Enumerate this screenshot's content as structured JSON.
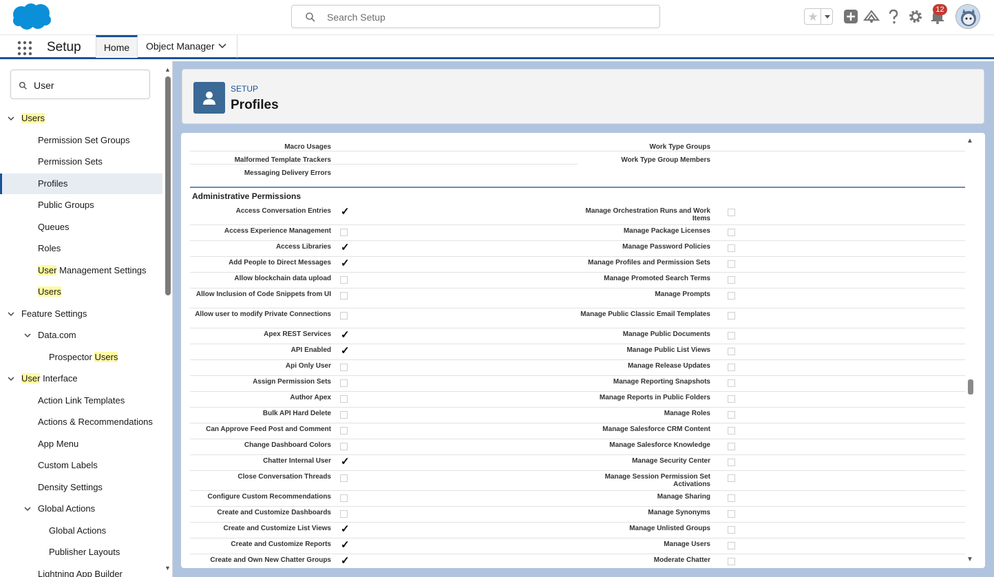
{
  "topbar": {
    "search_placeholder": "Search Setup",
    "notification_count": "12"
  },
  "nav": {
    "app_name": "Setup",
    "tabs": [
      "Home",
      "Object Manager"
    ]
  },
  "sidebar": {
    "search_value": "User",
    "items": [
      {
        "pre": "",
        "hl": "Users",
        "post": "",
        "level": 0,
        "chevron": "down"
      },
      {
        "pre": "Permission Set Groups",
        "hl": "",
        "post": "",
        "level": 1
      },
      {
        "pre": "Permission Sets",
        "hl": "",
        "post": "",
        "level": 1
      },
      {
        "pre": "Profiles",
        "hl": "",
        "post": "",
        "level": 1,
        "selected": true
      },
      {
        "pre": "Public Groups",
        "hl": "",
        "post": "",
        "level": 1
      },
      {
        "pre": "Queues",
        "hl": "",
        "post": "",
        "level": 1
      },
      {
        "pre": "Roles",
        "hl": "",
        "post": "",
        "level": 1
      },
      {
        "pre": "",
        "hl": "User",
        "post": " Management Settings",
        "level": 1
      },
      {
        "pre": "",
        "hl": "Users",
        "post": "",
        "level": 1
      },
      {
        "pre": "Feature Settings",
        "hl": "",
        "post": "",
        "level": 0,
        "chevron": "down"
      },
      {
        "pre": "Data.com",
        "hl": "",
        "post": "",
        "level": 1,
        "chevron": "down"
      },
      {
        "pre": "Prospector ",
        "hl": "Users",
        "post": "",
        "level": 2
      },
      {
        "pre": "",
        "hl": "User",
        "post": " Interface",
        "level": 0,
        "chevron": "down"
      },
      {
        "pre": "Action Link Templates",
        "hl": "",
        "post": "",
        "level": 1
      },
      {
        "pre": "Actions & Recommendations",
        "hl": "",
        "post": "",
        "level": 1
      },
      {
        "pre": "App Menu",
        "hl": "",
        "post": "",
        "level": 1
      },
      {
        "pre": "Custom Labels",
        "hl": "",
        "post": "",
        "level": 1
      },
      {
        "pre": "Density Settings",
        "hl": "",
        "post": "",
        "level": 1
      },
      {
        "pre": "Global Actions",
        "hl": "",
        "post": "",
        "level": 1,
        "chevron": "down"
      },
      {
        "pre": "Global Actions",
        "hl": "",
        "post": "",
        "level": 2
      },
      {
        "pre": "Publisher Layouts",
        "hl": "",
        "post": "",
        "level": 2
      },
      {
        "pre": "Lightning App Builder",
        "hl": "",
        "post": "",
        "level": 1
      }
    ]
  },
  "header": {
    "breadcrumb": "SETUP",
    "title": "Profiles"
  },
  "top_rows": {
    "left": [
      "Macro Usages",
      "Malformed Template Trackers",
      "Messaging Delivery Errors"
    ],
    "right": [
      "Work Type Groups",
      "Work Type Group Members"
    ]
  },
  "section_title": "Administrative Permissions",
  "permissions": [
    {
      "left": "Access Conversation Entries",
      "lc": true,
      "right": "Manage Orchestration Runs and Work Items",
      "rc": false
    },
    {
      "left": "Access Experience Management",
      "lc": false,
      "right": "Manage Package Licenses",
      "rc": false
    },
    {
      "left": "Access Libraries",
      "lc": true,
      "right": "Manage Password Policies",
      "rc": false
    },
    {
      "left": "Add People to Direct Messages",
      "lc": true,
      "right": "Manage Profiles and Permission Sets",
      "rc": false
    },
    {
      "left": "Allow blockchain data upload",
      "lc": false,
      "right": "Manage Promoted Search Terms",
      "rc": false
    },
    {
      "left": "Allow Inclusion of Code Snippets from UI",
      "lc": false,
      "right": "Manage Prompts",
      "rc": false
    },
    {
      "left": "Allow user to modify Private Connections",
      "lc": false,
      "right": "Manage Public Classic Email Templates",
      "rc": false
    },
    {
      "left": "Apex REST Services",
      "lc": true,
      "right": "Manage Public Documents",
      "rc": false
    },
    {
      "left": "API Enabled",
      "lc": true,
      "right": "Manage Public List Views",
      "rc": false
    },
    {
      "left": "Api Only User",
      "lc": false,
      "right": "Manage Release Updates",
      "rc": false
    },
    {
      "left": "Assign Permission Sets",
      "lc": false,
      "right": "Manage Reporting Snapshots",
      "rc": false
    },
    {
      "left": "Author Apex",
      "lc": false,
      "right": "Manage Reports in Public Folders",
      "rc": false
    },
    {
      "left": "Bulk API Hard Delete",
      "lc": false,
      "right": "Manage Roles",
      "rc": false
    },
    {
      "left": "Can Approve Feed Post and Comment",
      "lc": false,
      "right": "Manage Salesforce CRM Content",
      "rc": false
    },
    {
      "left": "Change Dashboard Colors",
      "lc": false,
      "right": "Manage Salesforce Knowledge",
      "rc": false
    },
    {
      "left": "Chatter Internal User",
      "lc": true,
      "right": "Manage Security Center",
      "rc": false
    },
    {
      "left": "Close Conversation Threads",
      "lc": false,
      "right": "Manage Session Permission Set Activations",
      "rc": false
    },
    {
      "left": "Configure Custom Recommendations",
      "lc": false,
      "right": "Manage Sharing",
      "rc": false
    },
    {
      "left": "Create and Customize Dashboards",
      "lc": false,
      "right": "Manage Synonyms",
      "rc": false
    },
    {
      "left": "Create and Customize List Views",
      "lc": true,
      "right": "Manage Unlisted Groups",
      "rc": false
    },
    {
      "left": "Create and Customize Reports",
      "lc": true,
      "right": "Manage Users",
      "rc": false
    },
    {
      "left": "Create and Own New Chatter Groups",
      "lc": true,
      "right": "Moderate Chatter",
      "rc": false
    }
  ],
  "colors": {
    "brand": "#0b5cab",
    "nav_accent": "#1b5297",
    "highlight": "#fffaa3",
    "badge": "#c23934"
  }
}
